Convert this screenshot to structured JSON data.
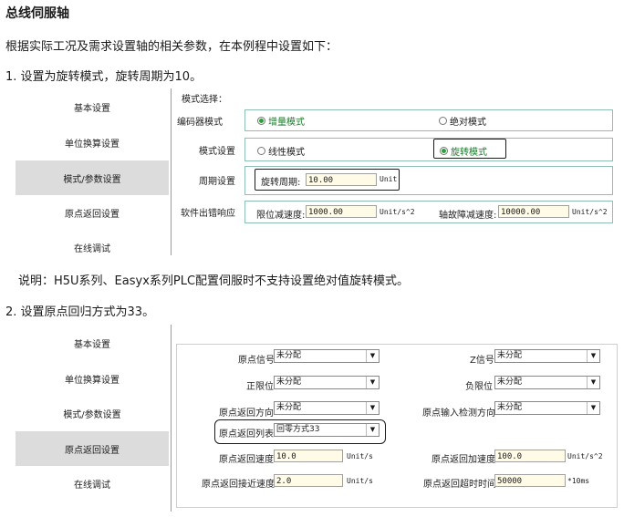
{
  "heading": "总线伺服轴",
  "intro": "根据实际工况及需求设置轴的相关参数，在本例程中设置如下：",
  "step1": "1. 设置为旋转模式，旋转周期为10。",
  "note": "说明：H5U系列、Easyx系列PLC配置伺服时不支持设置绝对值旋转模式。",
  "step2": "2. 设置原点回归方式为33。",
  "sidebar1": [
    "基本设置",
    "单位换算设置",
    "模式/参数设置",
    "原点返回设置",
    "在线调试"
  ],
  "sidebar2": [
    "基本设置",
    "单位换算设置",
    "模式/参数设置",
    "原点返回设置",
    "在线调试"
  ],
  "panel1": {
    "mode_select": "模式选择：",
    "encoder_mode_label": "编码器模式",
    "encoder_opt1": "增量模式",
    "encoder_opt2": "绝对模式",
    "mode_setting_label": "模式设置",
    "mode_opt1": "线性模式",
    "mode_opt2": "旋转模式",
    "period_label": "周期设置",
    "period_field_label": "旋转周期:",
    "period_value": "10.00",
    "period_unit": "Unit",
    "soft_limit_label": "软件出错响应",
    "limit_decel_label": "限位减速度:",
    "limit_decel_value": "1000.00",
    "limit_decel_unit": "Unit/s^2",
    "fault_decel_label": "轴故障减速度:",
    "fault_decel_value": "10000.00",
    "fault_decel_unit": "Unit/s^2"
  },
  "panel2": {
    "origin_signal_label": "原点信号",
    "origin_signal_value": "未分配",
    "z_signal_label": "Z信号",
    "z_signal_value": "未分配",
    "pos_limit_label": "正限位",
    "pos_limit_value": "未分配",
    "neg_limit_label": "负限位",
    "neg_limit_value": "未分配",
    "return_dir_label": "原点返回方向",
    "return_dir_value": "未分配",
    "input_dir_label": "原点输入检测方向",
    "input_dir_value": "未分配",
    "return_list_label": "原点返回列表",
    "return_list_value": "回零方式33",
    "return_speed_label": "原点返回速度",
    "return_speed_value": "10.0",
    "return_speed_unit": "Unit/s",
    "return_accel_label": "原点返回加速度",
    "return_accel_value": "100.0",
    "return_accel_unit": "Unit/s^2",
    "approach_speed_label": "原点返回接近速度",
    "approach_speed_value": "2.0",
    "approach_speed_unit": "Unit/s",
    "timeout_label": "原点返回超时时间",
    "timeout_value": "50000",
    "timeout_unit": "*10ms"
  }
}
